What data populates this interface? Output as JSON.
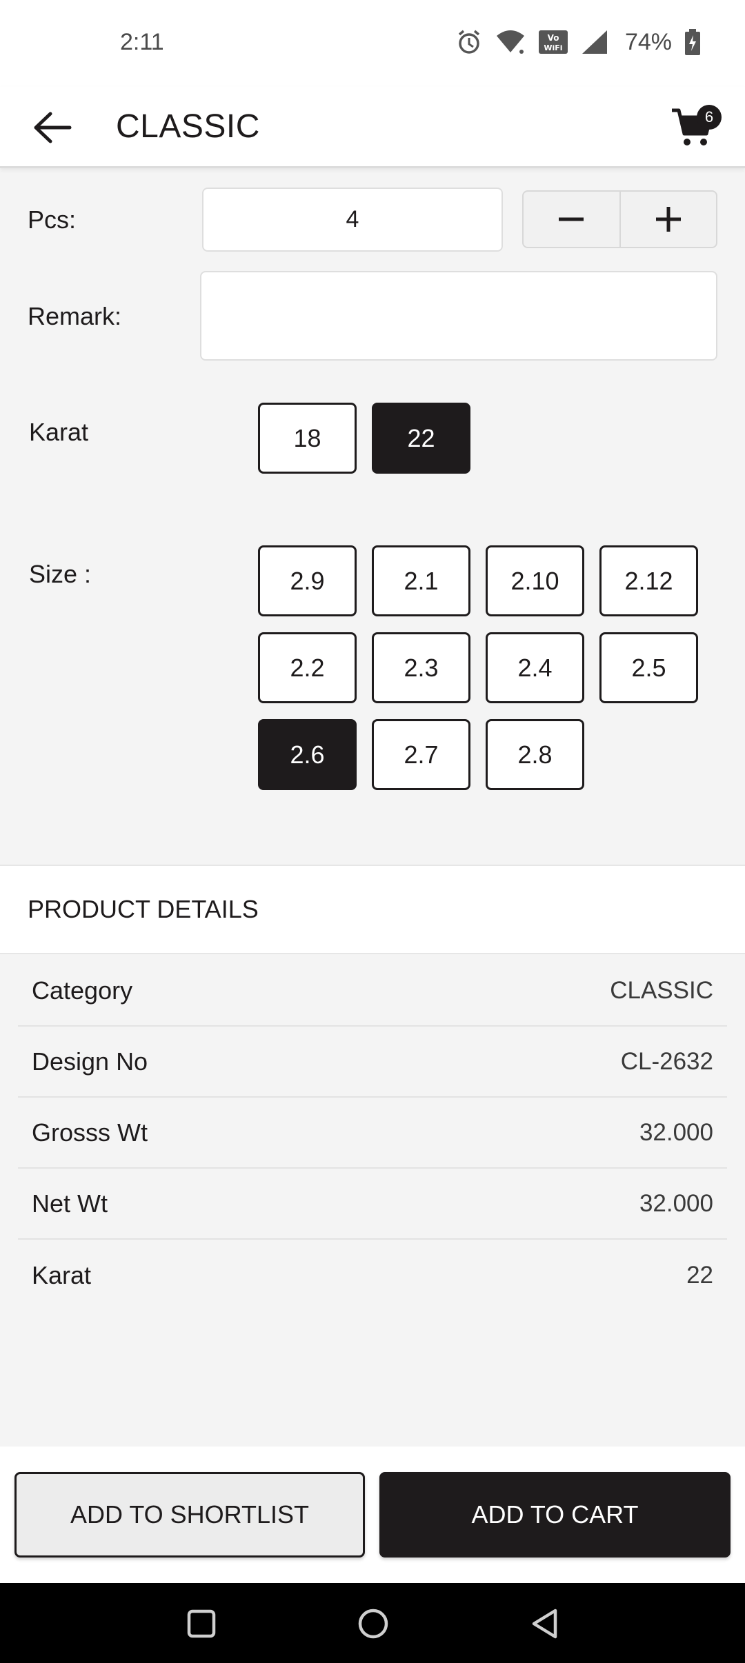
{
  "status_bar": {
    "time": "2:11",
    "battery": "74%",
    "icons": [
      "alarm-icon",
      "wifi-icon",
      "vowifi-icon",
      "signal-icon",
      "battery-charging-icon"
    ]
  },
  "app_bar": {
    "title": "CLASSIC",
    "cart_count": "6",
    "icons": [
      "back-arrow-icon",
      "cart-icon"
    ]
  },
  "form": {
    "pcs_label": "Pcs:",
    "pcs_value": "4",
    "remark_label": "Remark:",
    "remark_value": "",
    "karat_label": "Karat",
    "karat_options": [
      "18",
      "22"
    ],
    "karat_selected": "22",
    "size_label": "Size :",
    "size_options": [
      "2.9",
      "2.1",
      "2.10",
      "2.12",
      "2.2",
      "2.3",
      "2.4",
      "2.5",
      "2.6",
      "2.7",
      "2.8"
    ],
    "size_selected": "2.6"
  },
  "details": {
    "title": "PRODUCT DETAILS",
    "rows": [
      {
        "key": "Category",
        "value": "CLASSIC"
      },
      {
        "key": "Design No",
        "value": "CL-2632"
      },
      {
        "key": "Grosss Wt",
        "value": "32.000"
      },
      {
        "key": "Net Wt",
        "value": "32.000"
      },
      {
        "key": "Karat",
        "value": "22"
      }
    ]
  },
  "actions": {
    "shortlist_label": "ADD TO SHORTLIST",
    "cart_label": "ADD TO CART"
  },
  "colors": {
    "primary": "#1e1b1c",
    "background": "#f4f4f4",
    "surface": "#ffffff"
  }
}
